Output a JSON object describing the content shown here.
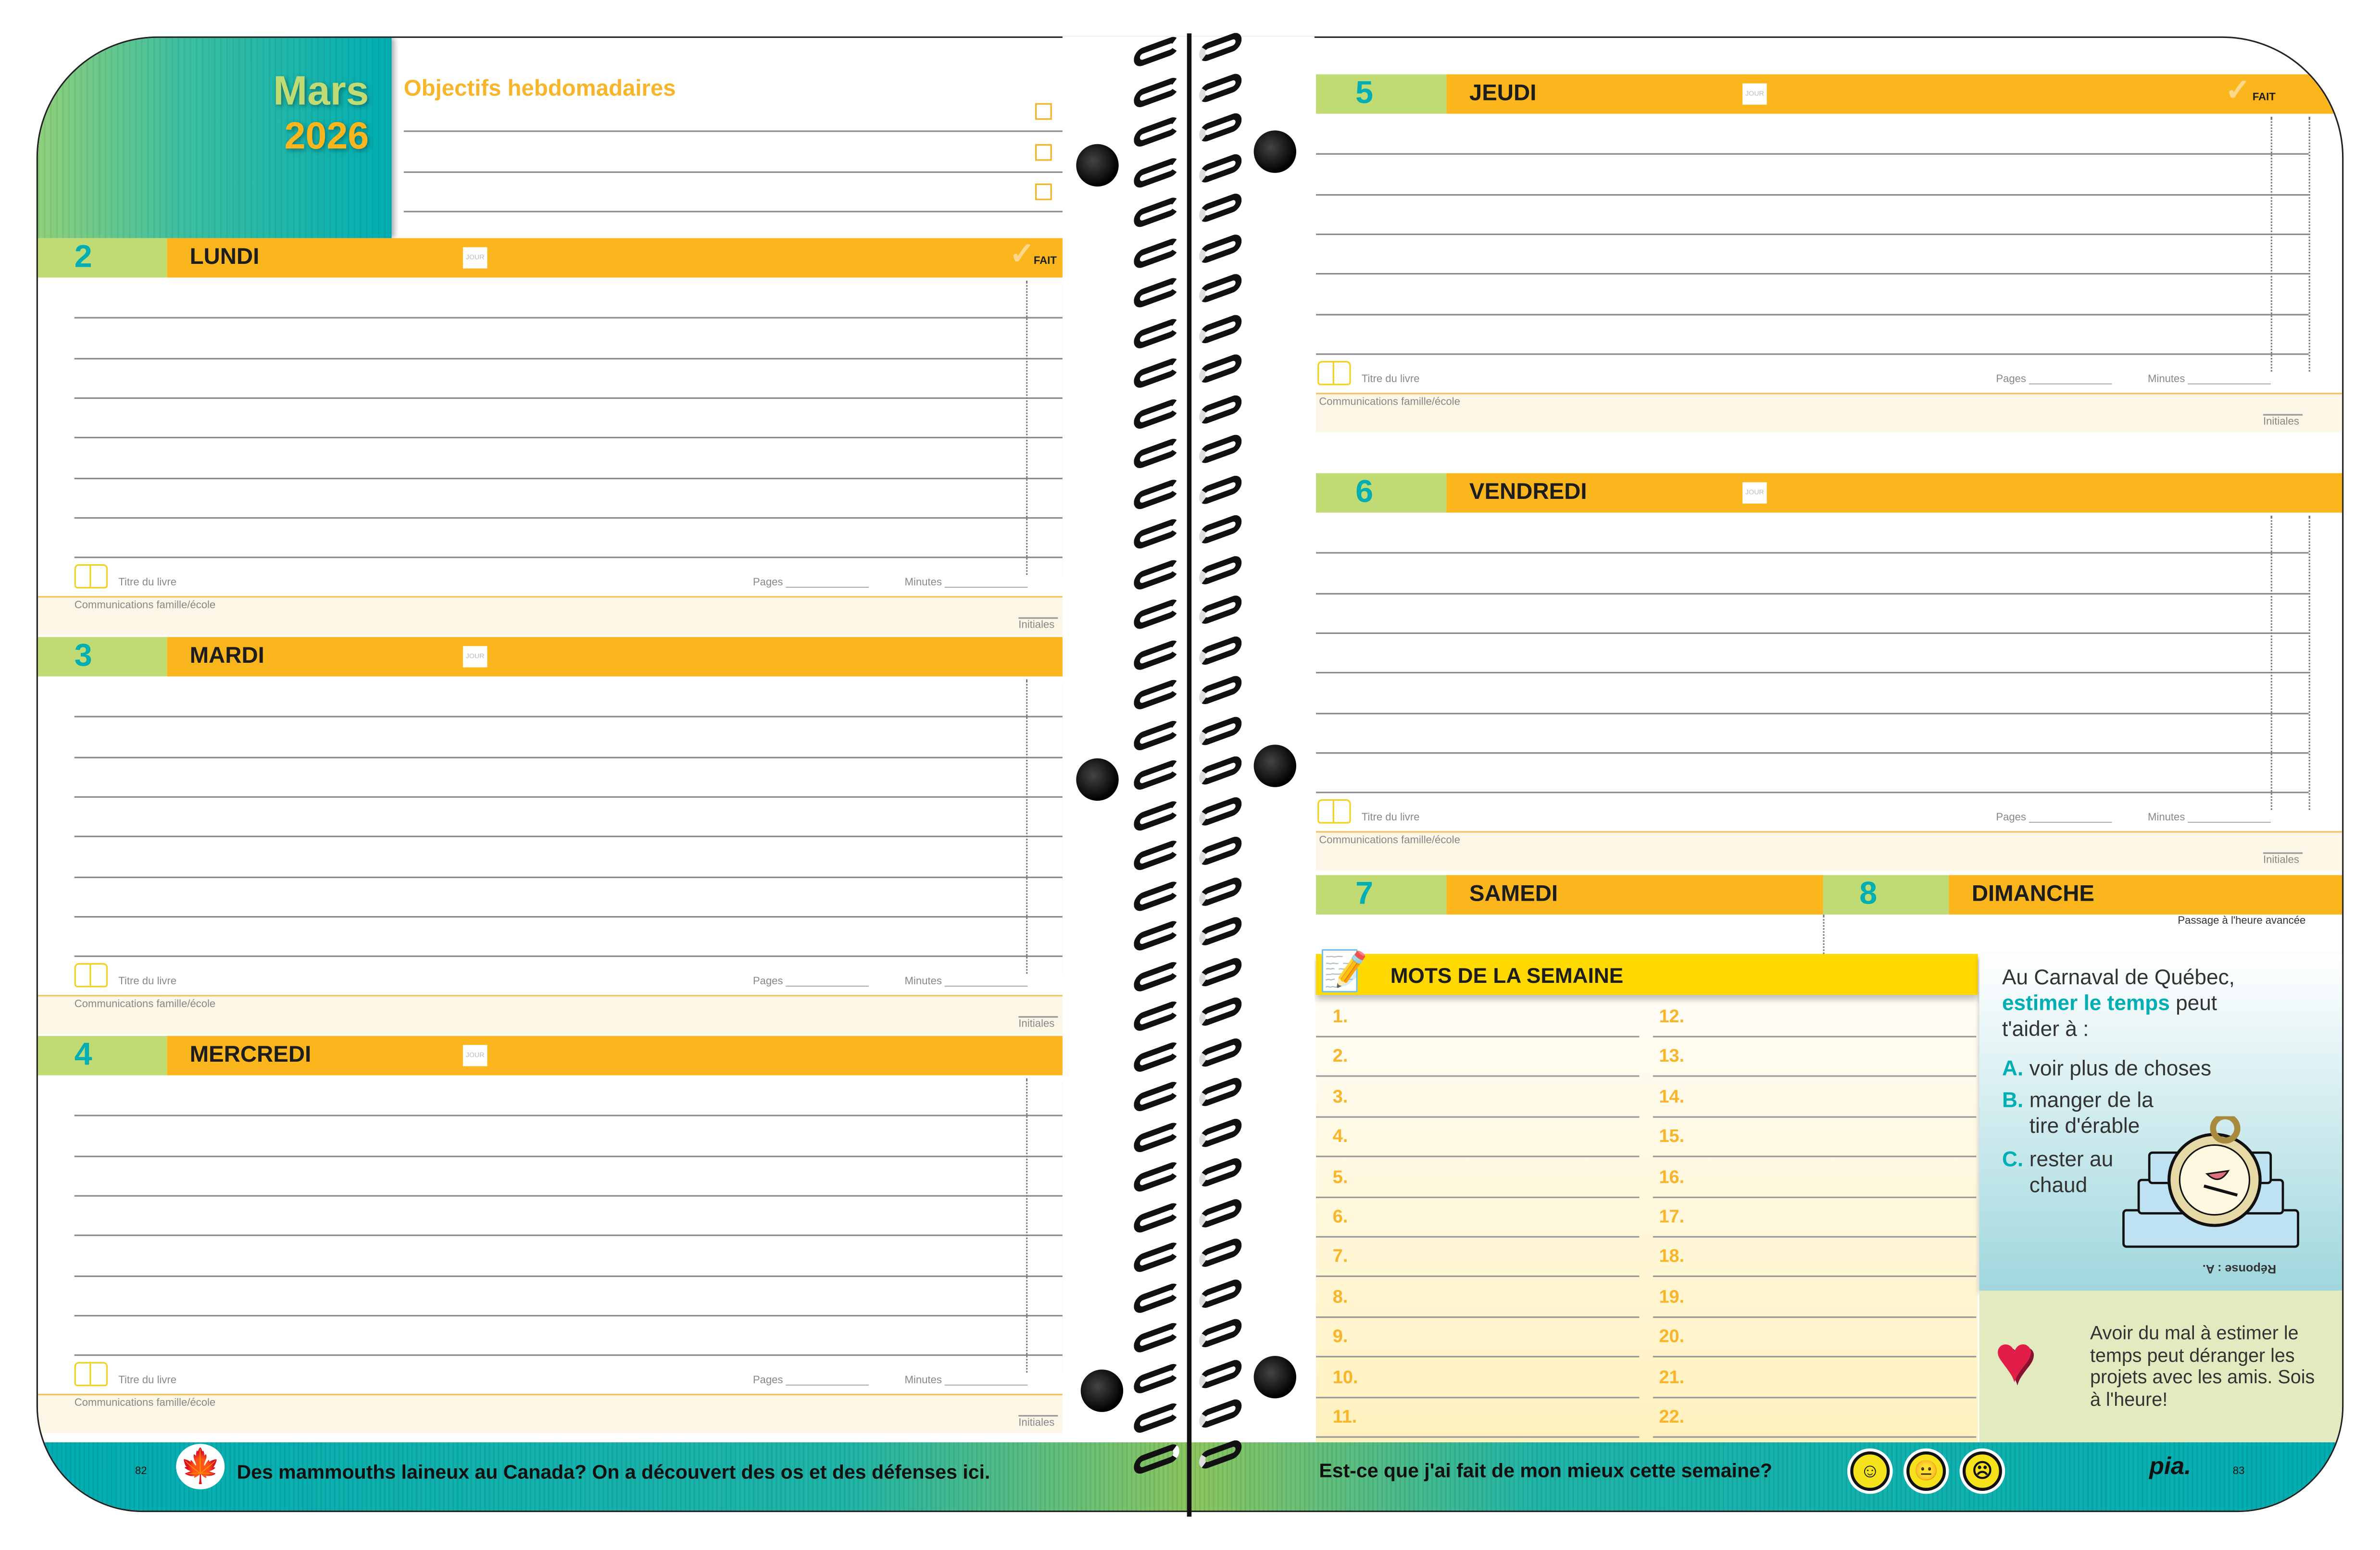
{
  "header": {
    "month": "Mars",
    "year": "2026",
    "objectives_title": "Objectifs hebdomadaires"
  },
  "labels": {
    "jour": "JOUR",
    "fait": "FAIT",
    "book_title": "Titre du livre",
    "pages": "Pages ______________",
    "minutes": "Minutes ______________",
    "communications": "Communications famille/école",
    "initiales": "Initiales"
  },
  "days": [
    {
      "number": "2",
      "name": "LUNDI"
    },
    {
      "number": "3",
      "name": "MARDI"
    },
    {
      "number": "4",
      "name": "MERCREDI"
    },
    {
      "number": "5",
      "name": "JEUDI"
    },
    {
      "number": "6",
      "name": "VENDREDI"
    },
    {
      "number": "7",
      "name": "SAMEDI"
    },
    {
      "number": "8",
      "name": "DIMANCHE",
      "note": "Passage à l'heure avancée"
    }
  ],
  "words": {
    "title": "MOTS DE LA SEMAINE",
    "numbers": [
      "1.",
      "2.",
      "3.",
      "4.",
      "5.",
      "6.",
      "7.",
      "8.",
      "9.",
      "10.",
      "11.",
      "12.",
      "13.",
      "14.",
      "15.",
      "16.",
      "17.",
      "18.",
      "19.",
      "20.",
      "21.",
      "22."
    ]
  },
  "quiz": {
    "intro": "Au Carnaval de Québec,",
    "highlight": "estimer le temps",
    "intro_end": "peut",
    "intro_end2": "t'aider à :",
    "options": [
      {
        "letter": "A.",
        "text": "voir plus de choses"
      },
      {
        "letter": "B.",
        "text": "manger de la tire d'érable"
      },
      {
        "letter": "C.",
        "text": "rester au chaud"
      }
    ],
    "answer": "Réponse : A."
  },
  "tip": "Avoir du mal à estimer le temps peut déranger les projets avec les amis. Sois à l'heure!",
  "footer": {
    "left_page": "82",
    "fact": "Des mammouths laineux au Canada? On a découvert des os et des défenses ici.",
    "question": "Est-ce que j'ai fait de mon mieux cette semaine?",
    "logo": "pia.",
    "right_page": "83"
  },
  "colors": {
    "orange": "#FBB61E",
    "green": "#C0DA74",
    "teal": "#00AEB3",
    "yellow": "#FFD900",
    "cream": "#FBF6E6"
  }
}
